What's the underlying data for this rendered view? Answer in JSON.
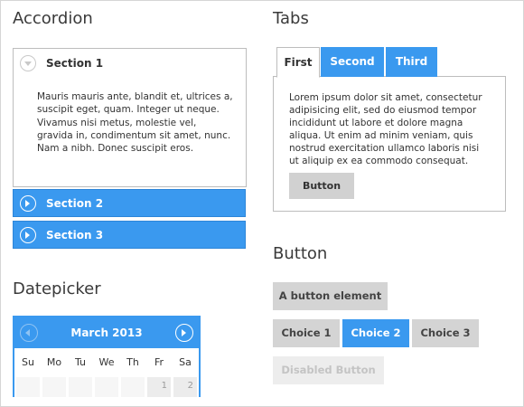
{
  "accordion": {
    "heading": "Accordion",
    "sections": [
      {
        "title": "Section 1",
        "body": "Mauris mauris ante, blandit et, ultrices a, suscipit eget, quam. Integer ut neque. Vivamus nisi metus, molestie vel, gravida in, condimentum sit amet, nunc. Nam a nibh. Donec suscipit eros."
      },
      {
        "title": "Section 2"
      },
      {
        "title": "Section 3"
      }
    ]
  },
  "datepicker": {
    "heading": "Datepicker",
    "month": "March 2013",
    "weekdays": [
      "Su",
      "Mo",
      "Tu",
      "We",
      "Th",
      "Fr",
      "Sa"
    ],
    "first_row": [
      "",
      "",
      "",
      "",
      "",
      "1",
      "2"
    ]
  },
  "tabs": {
    "heading": "Tabs",
    "items": [
      "First",
      "Second",
      "Third"
    ],
    "active": "First",
    "content": "Lorem ipsum dolor sit amet, consectetur adipisicing elit, sed do eiusmod tempor incididunt ut labore et dolore magna aliqua. Ut enim ad minim veniam, quis nostrud exercitation ullamco laboris nisi ut aliquip ex ea commodo consequat.",
    "button_label": "Button"
  },
  "button": {
    "heading": "Button",
    "element_label": "A button element",
    "choices": [
      "Choice 1",
      "Choice 2",
      "Choice 3"
    ],
    "selected_choice": "Choice 2",
    "disabled_label": "Disabled Button"
  },
  "colors": {
    "accent": "#3a99ef",
    "button_gray": "#d4d4d4",
    "disabled_bg": "#ededed",
    "disabled_text": "#c4c4c4"
  }
}
